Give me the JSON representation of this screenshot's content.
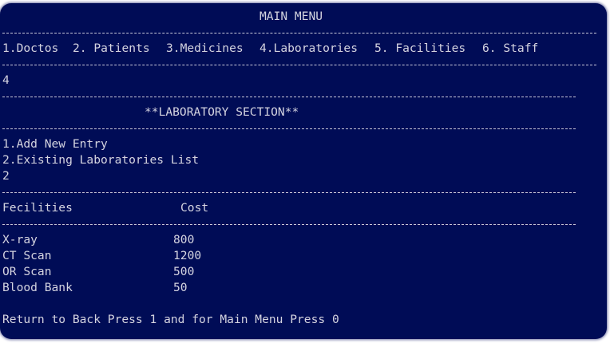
{
  "title": "MAIN MENU",
  "menu": [
    "1.Doctos",
    "2. Patients",
    "3.Medicines",
    "4.Laboratories",
    "5. Facilities",
    "6. Staff"
  ],
  "main_choice": "4",
  "section_title": "**LABORATORY SECTION**",
  "sub_menu": [
    "1.Add New Entry",
    "2.Existing Laboratories List"
  ],
  "sub_choice": "2",
  "table": {
    "headers": [
      "Fecilities",
      "Cost"
    ],
    "rows": [
      [
        "X-ray",
        "800"
      ],
      [
        "CT Scan",
        "1200"
      ],
      [
        "OR Scan",
        "500"
      ],
      [
        "Blood Bank",
        "50"
      ]
    ]
  },
  "footer": "Return to Back Press 1 and for Main Menu Press 0"
}
